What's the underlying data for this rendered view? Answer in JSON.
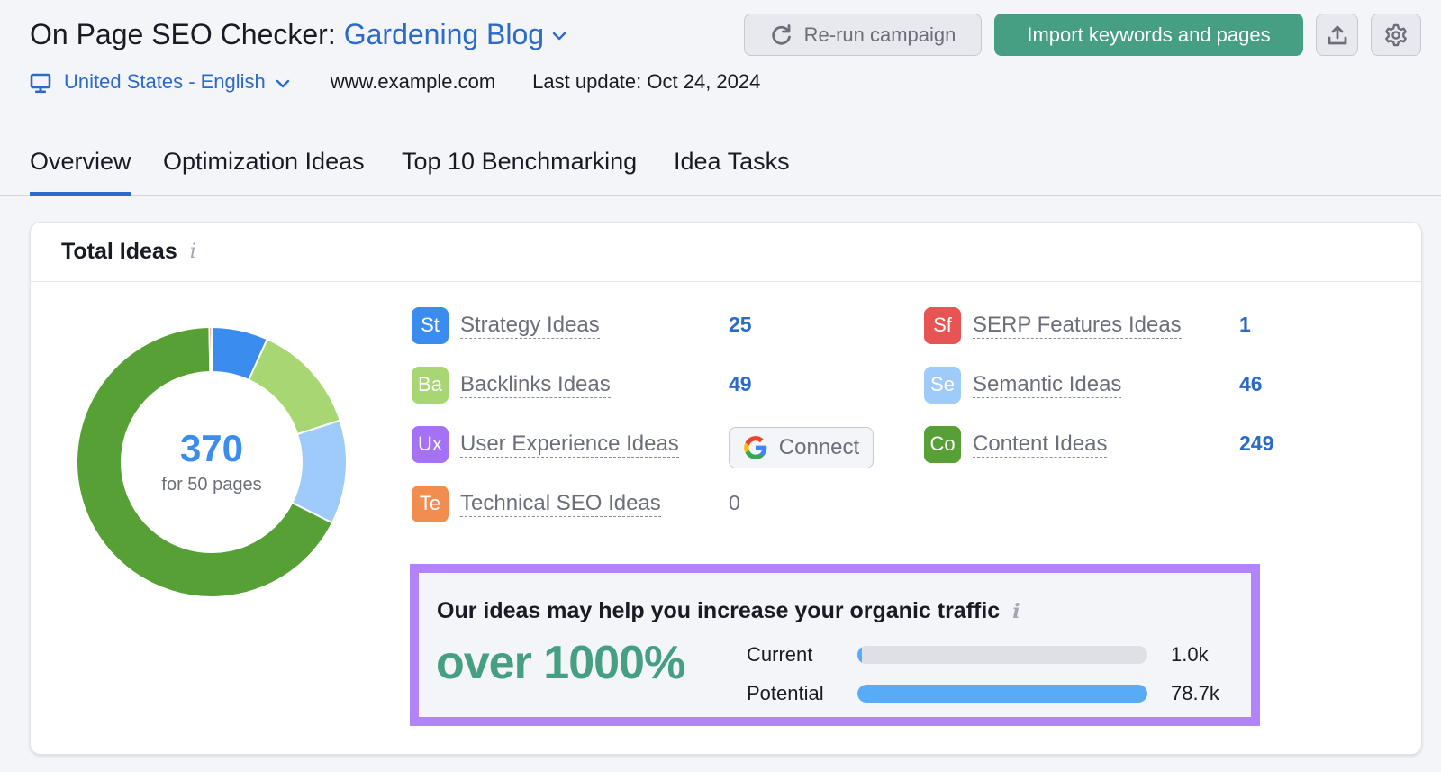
{
  "header": {
    "title": "On Page SEO Checker:",
    "project": "Gardening Blog",
    "locale": "United States - English",
    "domain": "www.example.com",
    "last_update": "Last update: Oct 24, 2024"
  },
  "actions": {
    "rerun_label": "Re-run campaign",
    "import_label": "Import keywords and pages"
  },
  "tabs": [
    {
      "label": "Overview",
      "active": true
    },
    {
      "label": "Optimization Ideas",
      "active": false
    },
    {
      "label": "Top 10 Benchmarking",
      "active": false
    },
    {
      "label": "Idea Tasks",
      "active": false
    }
  ],
  "card": {
    "title": "Total Ideas",
    "info": "i",
    "total": "370",
    "total_sub": "for 50 pages"
  },
  "ideas": [
    {
      "abbr": "St",
      "label": "Strategy Ideas",
      "count": "25",
      "color": "#3b8cef"
    },
    {
      "abbr": "Ba",
      "label": "Backlinks Ideas",
      "count": "49",
      "color": "#a8d672"
    },
    {
      "abbr": "Ux",
      "label": "User Experience Ideas",
      "count": null,
      "color": "#a571f5"
    },
    {
      "abbr": "Te",
      "label": "Technical SEO Ideas",
      "count": "0",
      "color": "#f08d4f"
    },
    {
      "abbr": "Sf",
      "label": "SERP Features Ideas",
      "count": "1",
      "color": "#e85454"
    },
    {
      "abbr": "Se",
      "label": "Semantic Ideas",
      "count": "46",
      "color": "#9ecbfa"
    },
    {
      "abbr": "Co",
      "label": "Content Ideas",
      "count": "249",
      "color": "#56a036"
    }
  ],
  "connect_label": "Connect",
  "traffic": {
    "title": "Our ideas may help you increase your organic traffic",
    "info": "i",
    "headline": "over 1000%",
    "rows": [
      {
        "label": "Current",
        "value": "1.0k",
        "fraction": 0.0127
      },
      {
        "label": "Potential",
        "value": "78.7k",
        "fraction": 1.0
      }
    ]
  },
  "chart_data": {
    "type": "pie",
    "variant": "donut",
    "title": "Total Ideas",
    "center_label": "370",
    "center_sublabel": "for 50 pages",
    "categories": [
      "Strategy Ideas",
      "Backlinks Ideas",
      "Semantic Ideas",
      "Content Ideas",
      "SERP Features Ideas"
    ],
    "values": [
      25,
      49,
      46,
      249,
      1
    ],
    "colors": [
      "#3b8cef",
      "#a8d672",
      "#9ecbfa",
      "#56a036",
      "#e85454"
    ]
  },
  "colors": {
    "accent_blue": "#2a6bc9",
    "primary_green": "#469f82",
    "highlight_purple": "#b383fa"
  }
}
